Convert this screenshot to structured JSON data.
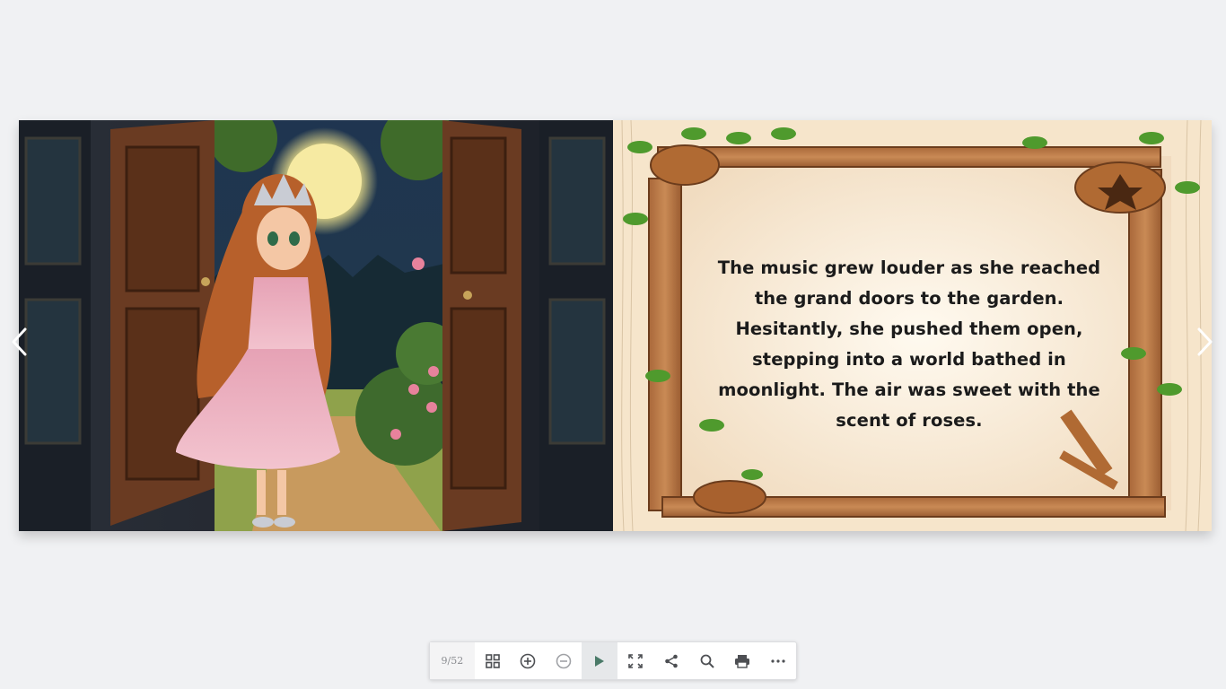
{
  "book": {
    "right_page_text": "The music grew louder as she reached the grand doors to the garden. Hesitantly, she pushed them open, stepping into a world bathed in moonlight. The air was sweet with the scent of roses."
  },
  "navigation": {
    "prev_icon": "chevron-left-icon",
    "next_icon": "chevron-right-icon"
  },
  "toolbar": {
    "page_counter": "9/52",
    "buttons": [
      {
        "icon": "grid-icon"
      },
      {
        "icon": "zoom-in-icon"
      },
      {
        "icon": "zoom-out-icon"
      },
      {
        "icon": "play-icon",
        "active": true
      },
      {
        "icon": "fullscreen-icon"
      },
      {
        "icon": "share-icon"
      },
      {
        "icon": "search-icon"
      },
      {
        "icon": "print-icon"
      },
      {
        "icon": "more-icon"
      }
    ]
  },
  "colors": {
    "background": "#f0f1f3",
    "accent_play": "#4a7a68",
    "icon": "#4d4f53"
  }
}
